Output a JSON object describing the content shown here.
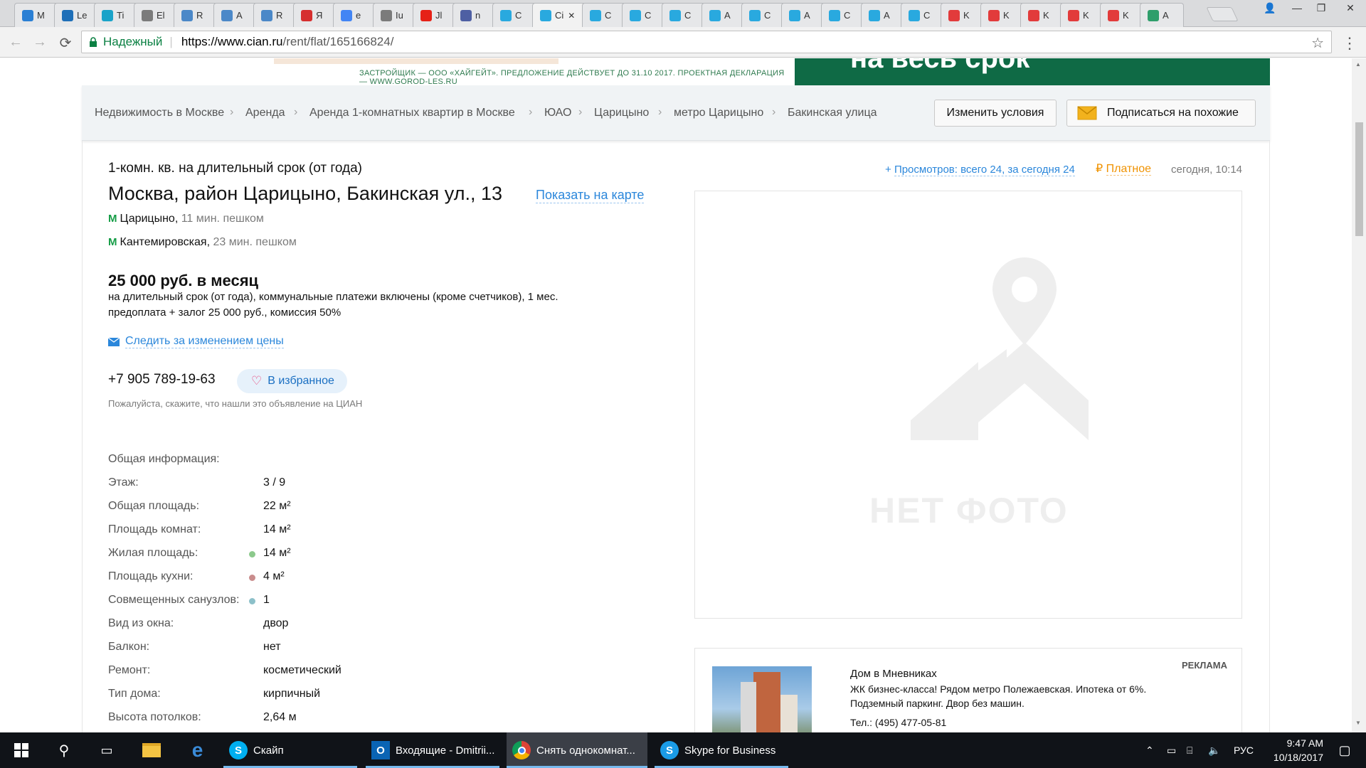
{
  "browser": {
    "tabs": [
      {
        "label": "M",
        "color": "#2a7fd4"
      },
      {
        "label": "Le",
        "color": "#1e6fb8"
      },
      {
        "label": "Ti",
        "color": "#1aa3c9"
      },
      {
        "label": "El",
        "color": "#7b7b7b"
      },
      {
        "label": "R",
        "color": "#4b88c8"
      },
      {
        "label": "A",
        "color": "#4b88c8"
      },
      {
        "label": "R",
        "color": "#4b88c8"
      },
      {
        "label": "Я",
        "color": "#d62f2f"
      },
      {
        "label": "e",
        "color": "#4285f4"
      },
      {
        "label": "Iu",
        "color": "#7b7b7b"
      },
      {
        "label": "Jl",
        "color": "#e62117"
      },
      {
        "label": "n",
        "color": "#4e5fa3"
      },
      {
        "label": "C",
        "color": "#29a9df"
      },
      {
        "label": "Ci",
        "color": "#29a9df"
      },
      {
        "label": "C",
        "color": "#29a9df"
      },
      {
        "label": "C",
        "color": "#29a9df"
      },
      {
        "label": "C",
        "color": "#29a9df"
      },
      {
        "label": "A",
        "color": "#29a9df"
      },
      {
        "label": "C",
        "color": "#29a9df"
      },
      {
        "label": "A",
        "color": "#29a9df"
      },
      {
        "label": "C",
        "color": "#29a9df"
      },
      {
        "label": "A",
        "color": "#29a9df"
      },
      {
        "label": "C",
        "color": "#29a9df"
      },
      {
        "label": "K",
        "color": "#e23b3b"
      },
      {
        "label": "K",
        "color": "#e23b3b"
      },
      {
        "label": "K",
        "color": "#e23b3b"
      },
      {
        "label": "K",
        "color": "#e23b3b"
      },
      {
        "label": "K",
        "color": "#e23b3b"
      },
      {
        "label": "A",
        "color": "#2f9e6b"
      }
    ],
    "active_tab_index": 13,
    "security_label": "Надежный",
    "url_host": "https://www.cian.ru",
    "url_path": "/rent/flat/165166824/"
  },
  "banner": {
    "developer_text": "ЗАСТРОЙЩИК — ООО «ХАЙГЕЙТ». ПРЕДЛОЖЕНИЕ ДЕЙСТВУЕТ ДО 31.10 2017. ПРОЕКТНАЯ ДЕКЛАРАЦИЯ — WWW.GOROD-LES.RU",
    "slogan": "на весь срок"
  },
  "breadcrumbs": [
    "Недвижимость в Москве",
    "Аренда",
    "Аренда 1-комнатных квартир в Москве",
    "ЮАО",
    "Царицыно",
    "метро Царицыно",
    "Бакинская улица"
  ],
  "actions": {
    "change_conditions": "Изменить условия",
    "subscribe_similar": "Подписаться на похожие"
  },
  "listing": {
    "type_title": "1-комн. кв. на длительный срок (от года)",
    "address": "Москва, район Царицыно, Бакинская ул., 13",
    "show_on_map": "Показать на карте",
    "metro": [
      {
        "station": "Царицыно,",
        "walk": "11 мин. пешком"
      },
      {
        "station": "Кантемировская,",
        "walk": "23 мин. пешком"
      }
    ],
    "price": "25 000 руб. в месяц",
    "price_terms_line1": "на длительный срок (от года), коммунальные платежи включены (кроме счетчиков), 1 мес.",
    "price_terms_line2": "предоплата + залог 25 000 руб., комиссия 50%",
    "watch_price": "Следить за изменением цены",
    "phone": "+7 905 789-19-63",
    "favorite": "В избранное",
    "hint": "Пожалуйста, скажите, что нашли это объявление на ЦИАН",
    "views_prefix": "+",
    "views": "Просмотров: всего 24, за сегодня 24",
    "paid_symbol": "₽",
    "paid": "Платное",
    "published": "сегодня, 10:14",
    "no_photo": "НЕТ ФОТО",
    "general_heading": "Общая информация:",
    "details": [
      {
        "label": "Этаж:",
        "value": "3 / 9",
        "dot": ""
      },
      {
        "label": "Общая площадь:",
        "value": "22 м²",
        "dot": ""
      },
      {
        "label": "Площадь комнат:",
        "value": "14 м²",
        "dot": ""
      },
      {
        "label": "Жилая площадь:",
        "value": "14 м²",
        "dot": "#8cc98c"
      },
      {
        "label": "Площадь кухни:",
        "value": "4 м²",
        "dot": "#c98c8c"
      },
      {
        "label": "Совмещенных санузлов:",
        "value": "1",
        "dot": "#8cc0c9"
      },
      {
        "label": "Вид из окна:",
        "value": "двор",
        "dot": ""
      },
      {
        "label": "Балкон:",
        "value": "нет",
        "dot": ""
      },
      {
        "label": "Ремонт:",
        "value": "косметический",
        "dot": ""
      },
      {
        "label": "Тип дома:",
        "value": "кирпичный",
        "dot": ""
      },
      {
        "label": "Высота потолков:",
        "value": "2,64 м",
        "dot": ""
      }
    ]
  },
  "ad": {
    "tag": "РЕКЛАМА",
    "title": "Дом в Мневниках",
    "text1": "ЖК бизнес-класса! Рядом метро Полежаевская. Ипотека от 6%.",
    "text2": "Подземный паркинг. Двор без машин.",
    "phone": "Тел.: (495) 477-05-81"
  },
  "taskbar": {
    "items": [
      {
        "label": "Скайп"
      },
      {
        "label": "Входящие - Dmitrii..."
      },
      {
        "label": "Снять однокомнат..."
      },
      {
        "label": "Skype for Business"
      }
    ],
    "lang": "РУС",
    "time": "9:47 AM",
    "date": "10/18/2017"
  }
}
